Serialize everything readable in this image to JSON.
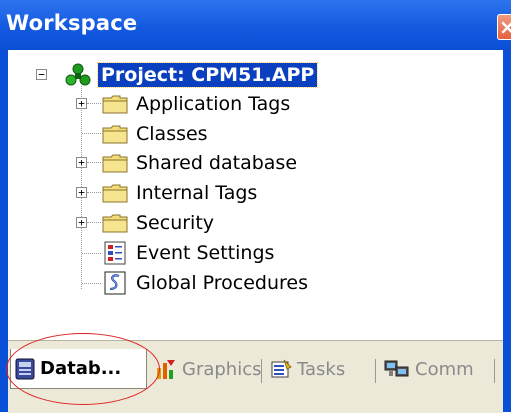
{
  "window": {
    "title": "Workspace",
    "close_glyph": "×"
  },
  "tree": {
    "root": {
      "label": "Project: CPM51.APP",
      "icon": "project-icon",
      "expander": "−",
      "selected": true
    },
    "items": [
      {
        "label": "Application Tags",
        "icon": "folder-icon",
        "expander": "+"
      },
      {
        "label": "Classes",
        "icon": "folder-icon",
        "expander": ""
      },
      {
        "label": "Shared database",
        "icon": "folder-icon",
        "expander": "+"
      },
      {
        "label": "Internal Tags",
        "icon": "folder-icon",
        "expander": "+"
      },
      {
        "label": "Security",
        "icon": "folder-icon",
        "expander": "+"
      },
      {
        "label": "Event Settings",
        "icon": "event-settings-icon",
        "expander": ""
      },
      {
        "label": "Global Procedures",
        "icon": "script-icon",
        "expander": ""
      }
    ]
  },
  "tabs": [
    {
      "label": "Datab...",
      "icon": "database-icon",
      "active": true
    },
    {
      "label": "Graphics",
      "icon": "graphics-icon",
      "active": false
    },
    {
      "label": "Tasks",
      "icon": "tasks-icon",
      "active": false
    },
    {
      "label": "Comm",
      "icon": "comm-icon",
      "active": false
    }
  ],
  "colors": {
    "titlebar": "#0b4fd6",
    "selection": "#0a3fc0",
    "annotation": "#e02020"
  }
}
